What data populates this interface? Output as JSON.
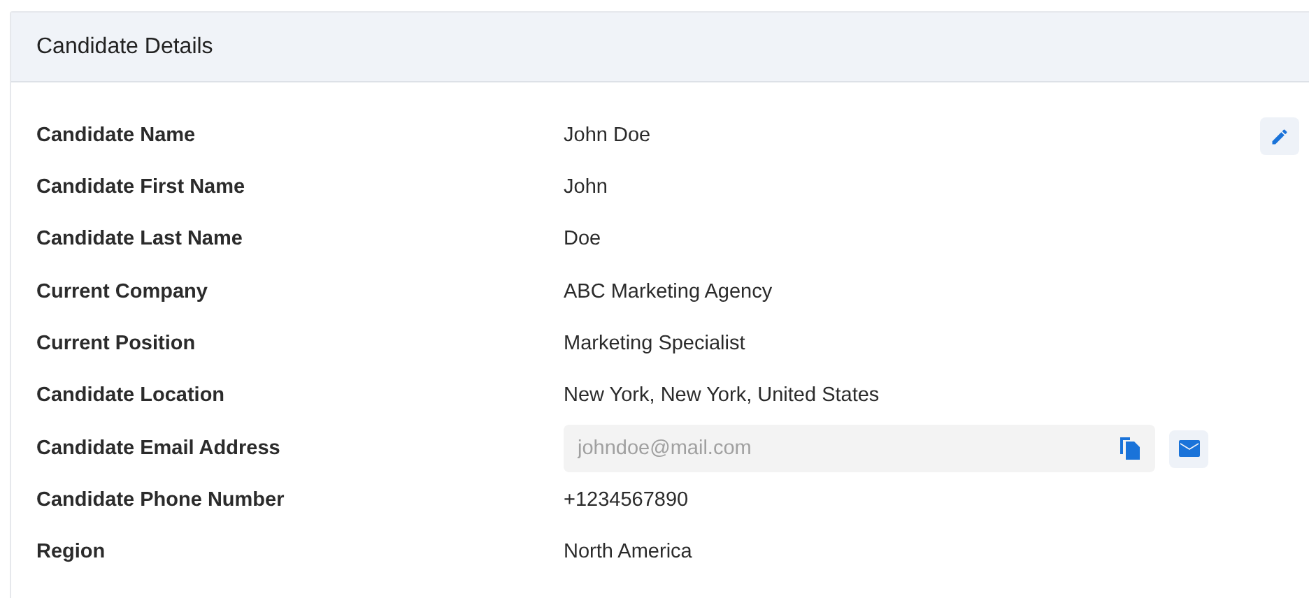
{
  "card": {
    "title": "Candidate Details"
  },
  "rows": [
    {
      "kind": "text",
      "label": "Candidate Name",
      "value": "John Doe"
    },
    {
      "kind": "text",
      "label": "Candidate First Name",
      "value": "John"
    },
    {
      "kind": "text",
      "label": "Candidate Last Name",
      "value": "Doe"
    },
    {
      "kind": "text",
      "label": "Current Company",
      "value": "ABC Marketing Agency"
    },
    {
      "kind": "text",
      "label": "Current Position",
      "value": "Marketing Specialist"
    },
    {
      "kind": "text",
      "label": "Candidate Location",
      "value": "New York, New York, United States"
    },
    {
      "kind": "email",
      "label": "Candidate Email Address",
      "value": "johndoe@mail.com",
      "disabled": true
    },
    {
      "kind": "text",
      "label": "Candidate Phone Number",
      "value": "+1234567890"
    },
    {
      "kind": "text",
      "label": "Region",
      "value": "North America"
    }
  ]
}
